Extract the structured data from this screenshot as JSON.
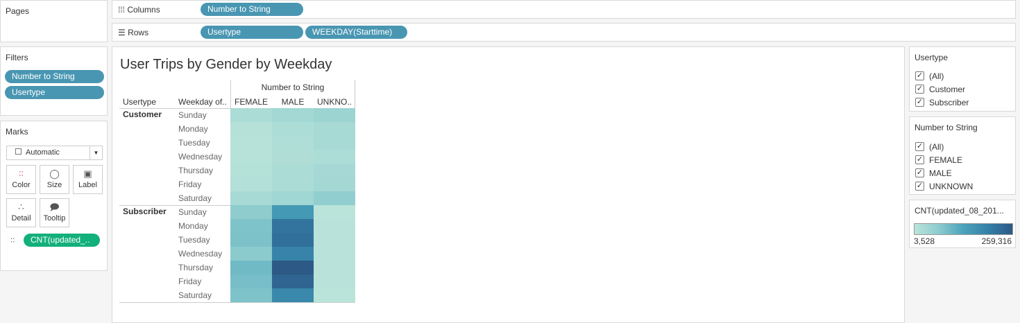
{
  "pages": {
    "title": "Pages"
  },
  "columns": {
    "label": "Columns",
    "pills": [
      "Number to String"
    ]
  },
  "rows": {
    "label": "Rows",
    "pills": [
      "Usertype",
      "WEEKDAY(Starttime)"
    ]
  },
  "filters": {
    "title": "Filters",
    "pills": [
      "Number to String",
      "Usertype"
    ]
  },
  "marks": {
    "title": "Marks",
    "type": "Automatic",
    "buttons": [
      {
        "label": "Color",
        "icon": "color-dots-icon"
      },
      {
        "label": "Size",
        "icon": "size-icon"
      },
      {
        "label": "Label",
        "icon": "label-icon"
      },
      {
        "label": "Detail",
        "icon": "detail-icon"
      },
      {
        "label": "Tooltip",
        "icon": "tooltip-icon"
      }
    ],
    "field": "CNT(updated_..",
    "field_color": "#13b07b"
  },
  "view": {
    "title": "User Trips by Gender by Weekday",
    "col_header": "Number to String",
    "row_headers": [
      "Usertype",
      "Weekday of.."
    ],
    "columns": [
      "FEMALE",
      "MALE",
      "UNKNO.."
    ]
  },
  "chart_data": {
    "type": "heatmap",
    "title": "User Trips by Gender by Weekday",
    "columns": [
      "FEMALE",
      "MALE",
      "UNKNOWN"
    ],
    "groups": [
      {
        "name": "Customer",
        "rows": [
          "Sunday",
          "Monday",
          "Tuesday",
          "Wednesday",
          "Thursday",
          "Friday",
          "Saturday"
        ],
        "values": [
          [
            25000,
            35000,
            45000
          ],
          [
            10000,
            22000,
            30000
          ],
          [
            9000,
            20000,
            28000
          ],
          [
            8000,
            18000,
            22000
          ],
          [
            12000,
            24000,
            32000
          ],
          [
            13000,
            25000,
            34000
          ],
          [
            28000,
            40000,
            60000
          ]
        ]
      },
      {
        "name": "Subscriber",
        "rows": [
          "Sunday",
          "Monday",
          "Tuesday",
          "Wednesday",
          "Thursday",
          "Friday",
          "Saturday"
        ],
        "values": [
          [
            65000,
            150000,
            4000
          ],
          [
            80000,
            215000,
            5000
          ],
          [
            82000,
            222000,
            5000
          ],
          [
            68000,
            190000,
            5000
          ],
          [
            95000,
            259316,
            5500
          ],
          [
            88000,
            240000,
            5000
          ],
          [
            80000,
            180000,
            3528
          ]
        ]
      }
    ],
    "color_range": [
      3528,
      259316
    ],
    "colors": [
      "#bae4da",
      "#8ccbce",
      "#4aa3ba",
      "#3580a8",
      "#2c5985"
    ]
  },
  "legend_usertype": {
    "title": "Usertype",
    "items": [
      "(All)",
      "Customer",
      "Subscriber"
    ]
  },
  "legend_gender": {
    "title": "Number to String",
    "items": [
      "(All)",
      "FEMALE",
      "MALE",
      "UNKNOWN"
    ]
  },
  "color_legend": {
    "title": "CNT(updated_08_201...",
    "min": "3,528",
    "max": "259,316"
  }
}
